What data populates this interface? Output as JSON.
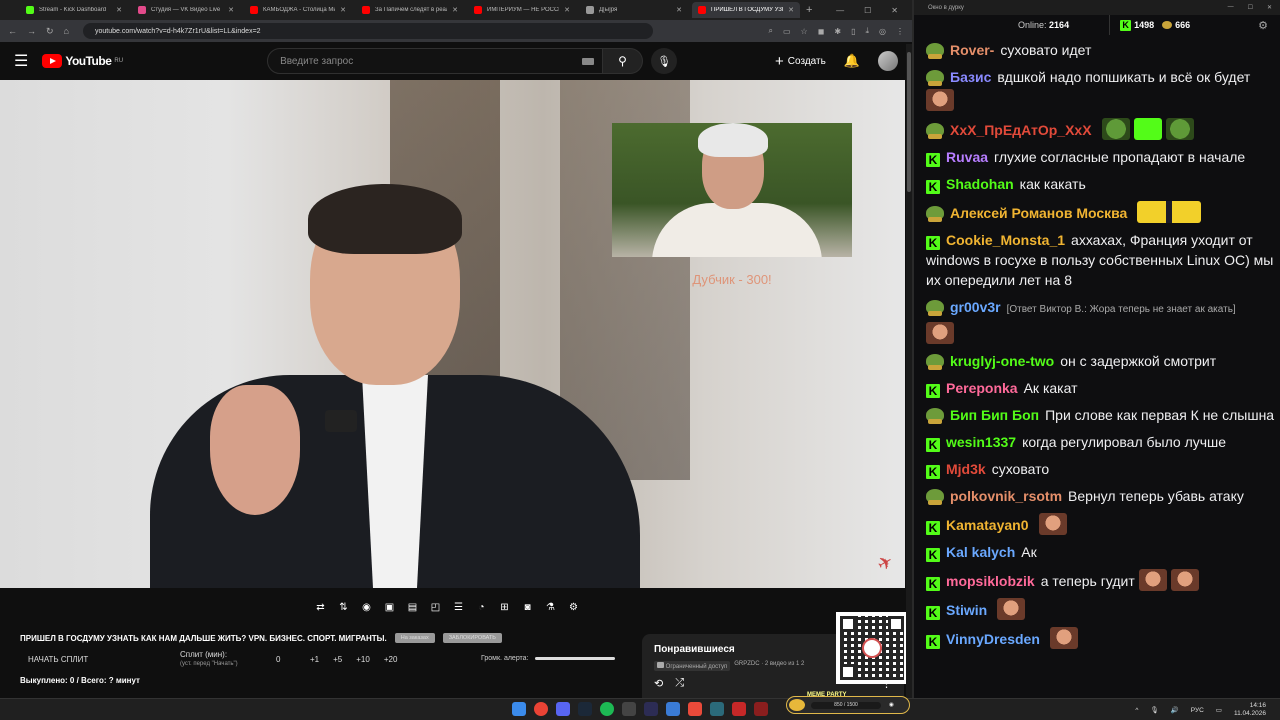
{
  "browser": {
    "tabs": [
      {
        "title": "Stream - Kick Dashboard",
        "color": "#53fc18",
        "active": false
      },
      {
        "title": "Студия — VK Видео Live",
        "color": "#e24a8a",
        "active": false
      },
      {
        "title": "КАМБОДЖА - Столица Ми...",
        "color": "#ff0000",
        "active": false
      },
      {
        "title": "За Папичем следят в реал...",
        "color": "#ff0000",
        "active": false
      },
      {
        "title": "ИМПЕРИУМ — НЕ РОССИ...",
        "color": "#ff0000",
        "active": false
      },
      {
        "title": "Д[ы]ря",
        "color": "#999999",
        "active": false
      },
      {
        "title": "ПРИШЕЛ В ГОСДУМУ УЗНА...",
        "color": "#ff0000",
        "active": true
      }
    ],
    "url": "youtube.com/watch?v=d-h4k7Zr1rU&list=LL&index=2"
  },
  "youtube": {
    "logo_text": "YouTube",
    "logo_region": "RU",
    "search_placeholder": "Введите запрос",
    "create_label": "Создать",
    "overlay_text": "Дубчик - 300!"
  },
  "widget": {
    "title": "ПРИШЕЛ В ГОСДУМУ УЗНАТЬ КАК НАМ ДАЛЬШЕ ЖИТЬ? VPN. БИЗНЕС. СПОРТ. МИГРАНТЫ.",
    "pill1": "На заказах",
    "pill2": "ЗАБЛОКИРОВАТЬ",
    "split_button": "НАЧАТЬ СПЛИТ",
    "split_label": "Сплит (мин):",
    "split_sub": "(уст. перед \"Начать\")",
    "split_value": "0",
    "inc1": "+1",
    "inc5": "+5",
    "inc10": "+10",
    "inc20": "+20",
    "alert_label": "Громк. алерта:",
    "bought": "Выкуплено: 0 / Всего: ? минут"
  },
  "liked": {
    "title": "Понравившиеся",
    "access": "Ограниченный доступ",
    "info": "GRPZDC · 2 видео из 1 2"
  },
  "chat": {
    "window_title": "Окно в дурку",
    "online_label": "Online:",
    "online_count": "2164",
    "stat1": "1498",
    "stat2": "666",
    "messages": [
      {
        "badge": "pepe",
        "user": "Rover-",
        "color": "#e58f6a",
        "text": "суховато идет",
        "emotes": []
      },
      {
        "badge": "pepe",
        "user": "Базис",
        "color": "#8a8aff",
        "text": "вдшкой надо попшикать и всё ок будет",
        "emotes": [
          "face"
        ]
      },
      {
        "badge": "pepe",
        "user": "ХхХ_ПрЕдАтОр_ХхХ",
        "color": "#e24a3a",
        "text": "",
        "emotes": [
          "pepe",
          "k",
          "pepe"
        ]
      },
      {
        "badge": "k",
        "user": "Ruvaa",
        "color": "#b77dff",
        "text": "глухие согласные пропадают в начале",
        "emotes": []
      },
      {
        "badge": "k",
        "user": "Shadohan",
        "color": "#53fc18",
        "text": "как какать",
        "emotes": []
      },
      {
        "badge": "pepe",
        "user": "Алексей Романов Москва",
        "color": "#f0b432",
        "text": "",
        "emotes": [
          "minion"
        ]
      },
      {
        "badge": "k",
        "user": "Cookie_Monsta_1",
        "color": "#f0b432",
        "text": "аххахах, Франция уходит от windows в госухе в пользу собственных Linux ОС) мы их опередили лет на 8",
        "emotes": []
      },
      {
        "badge": "pepe",
        "user": "gr00v3r",
        "color": "#6aa8ff",
        "text": "",
        "reply": "[Ответ Виктор В.: Жора теперь не знает ак акать]",
        "emotes": [
          "face"
        ]
      },
      {
        "badge": "pepe",
        "user": "kruglyj-one-two",
        "color": "#53fc18",
        "text": "он с задержкой смотрит",
        "emotes": []
      },
      {
        "badge": "k",
        "user": "Pereponka",
        "color": "#ff6a9a",
        "text": "Ак какат",
        "emotes": []
      },
      {
        "badge": "pepe",
        "user": "Бип Бип Боп",
        "color": "#53fc18",
        "text": "При слове как первая К не слышна",
        "emotes": []
      },
      {
        "badge": "k",
        "user": "wesin1337",
        "color": "#53fc18",
        "text": "когда регулировал было лучше",
        "emotes": []
      },
      {
        "badge": "k",
        "user": "Mjd3k",
        "color": "#e24a3a",
        "text": "суховато",
        "emotes": []
      },
      {
        "badge": "pepe",
        "user": "polkovnik_rsotm",
        "color": "#e58f6a",
        "text": "Вернул теперь убавь атаку",
        "emotes": []
      },
      {
        "badge": "k",
        "user": "Kamatayan0",
        "color": "#f0b432",
        "text": "",
        "emotes": [
          "face"
        ]
      },
      {
        "badge": "k",
        "user": "Kal kalych",
        "color": "#6aa8ff",
        "text": "Ак",
        "emotes": []
      },
      {
        "badge": "k",
        "user": "mopsiklobzik",
        "color": "#ff6a9a",
        "text": "а теперь гудит",
        "emotes": [
          "face",
          "face"
        ]
      },
      {
        "badge": "k",
        "user": "Stiwin",
        "color": "#6aa8ff",
        "text": "",
        "emotes": [
          "face"
        ]
      },
      {
        "badge": "k",
        "user": "VinnyDresden",
        "color": "#6aa8ff",
        "text": "",
        "emotes": [
          "face"
        ]
      }
    ]
  },
  "taskbar": {
    "meme_title": "MEME PARTY",
    "meme_progress": "850 / 1500",
    "lang": "РУС",
    "time": "14:16",
    "date": "11.04.2026"
  }
}
